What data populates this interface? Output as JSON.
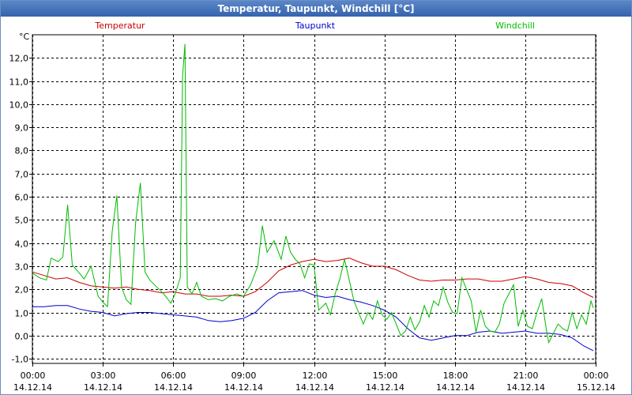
{
  "window": {
    "title": "Temperatur, Taupunkt, Windchill [°C]"
  },
  "chart_data": {
    "type": "line",
    "title": "Temperatur, Taupunkt, Windchill [°C]",
    "ylabel": "°C",
    "xlabel": "",
    "ylim": [
      -1.2,
      13.0
    ],
    "yticks": [
      -1.0,
      0.0,
      1.0,
      2.0,
      3.0,
      4.0,
      5.0,
      6.0,
      7.0,
      8.0,
      9.0,
      10.0,
      11.0,
      12.0
    ],
    "ytick_labels": [
      "-1,0",
      "0,0",
      "1,0",
      "2,0",
      "3,0",
      "4,0",
      "5,0",
      "6,0",
      "7,0",
      "8,0",
      "9,0",
      "10,0",
      "11,0",
      "12,0"
    ],
    "xlim": [
      0,
      24
    ],
    "xticks": [
      {
        "h": 0,
        "time": "00:00",
        "date": "14.12.14"
      },
      {
        "h": 3,
        "time": "03:00",
        "date": "14.12.14"
      },
      {
        "h": 6,
        "time": "06:00",
        "date": "14.12.14"
      },
      {
        "h": 9,
        "time": "09:00",
        "date": "14.12.14"
      },
      {
        "h": 12,
        "time": "12:00",
        "date": "14.12.14"
      },
      {
        "h": 15,
        "time": "15:00",
        "date": "14.12.14"
      },
      {
        "h": 18,
        "time": "18:00",
        "date": "14.12.14"
      },
      {
        "h": 21,
        "time": "21:00",
        "date": "14.12.14"
      },
      {
        "h": 24,
        "time": "00:00",
        "date": "15.12.14"
      }
    ],
    "grid": true,
    "legend_position": "top",
    "series": [
      {
        "name": "Temperatur",
        "color": "#cc0000",
        "points": [
          [
            0,
            2.75
          ],
          [
            0.5,
            2.6
          ],
          [
            1,
            2.45
          ],
          [
            1.5,
            2.5
          ],
          [
            2,
            2.3
          ],
          [
            2.5,
            2.15
          ],
          [
            3,
            2.1
          ],
          [
            3.5,
            2.05
          ],
          [
            4,
            2.1
          ],
          [
            4.5,
            2.0
          ],
          [
            5,
            1.95
          ],
          [
            5.5,
            1.85
          ],
          [
            6,
            1.9
          ],
          [
            6.5,
            1.8
          ],
          [
            7,
            1.8
          ],
          [
            7.5,
            1.7
          ],
          [
            8,
            1.7
          ],
          [
            8.5,
            1.75
          ],
          [
            9,
            1.7
          ],
          [
            9.5,
            1.9
          ],
          [
            10,
            2.3
          ],
          [
            10.5,
            2.8
          ],
          [
            11,
            3.05
          ],
          [
            11.5,
            3.2
          ],
          [
            12,
            3.3
          ],
          [
            12.5,
            3.2
          ],
          [
            13,
            3.25
          ],
          [
            13.5,
            3.35
          ],
          [
            14,
            3.15
          ],
          [
            14.5,
            3.0
          ],
          [
            15,
            3.0
          ],
          [
            15.5,
            2.85
          ],
          [
            16,
            2.6
          ],
          [
            16.5,
            2.4
          ],
          [
            17,
            2.35
          ],
          [
            17.5,
            2.4
          ],
          [
            18,
            2.4
          ],
          [
            18.5,
            2.45
          ],
          [
            19,
            2.45
          ],
          [
            19.5,
            2.35
          ],
          [
            20,
            2.35
          ],
          [
            20.5,
            2.45
          ],
          [
            21,
            2.55
          ],
          [
            21.5,
            2.45
          ],
          [
            22,
            2.3
          ],
          [
            22.5,
            2.25
          ],
          [
            23,
            2.15
          ],
          [
            23.5,
            1.85
          ],
          [
            23.9,
            1.65
          ]
        ]
      },
      {
        "name": "Taupunkt",
        "color": "#0000cc",
        "points": [
          [
            0,
            1.25
          ],
          [
            0.5,
            1.25
          ],
          [
            1,
            1.3
          ],
          [
            1.5,
            1.3
          ],
          [
            2,
            1.15
          ],
          [
            2.5,
            1.05
          ],
          [
            3,
            1.0
          ],
          [
            3.5,
            0.85
          ],
          [
            4,
            0.95
          ],
          [
            4.5,
            1.0
          ],
          [
            5,
            1.0
          ],
          [
            5.5,
            0.95
          ],
          [
            6,
            0.9
          ],
          [
            6.5,
            0.85
          ],
          [
            7,
            0.8
          ],
          [
            7.5,
            0.65
          ],
          [
            8,
            0.6
          ],
          [
            8.5,
            0.65
          ],
          [
            9,
            0.75
          ],
          [
            9.5,
            1.0
          ],
          [
            10,
            1.5
          ],
          [
            10.5,
            1.85
          ],
          [
            11,
            1.9
          ],
          [
            11.5,
            1.95
          ],
          [
            12,
            1.75
          ],
          [
            12.5,
            1.65
          ],
          [
            13,
            1.7
          ],
          [
            13.5,
            1.55
          ],
          [
            14,
            1.45
          ],
          [
            14.5,
            1.3
          ],
          [
            15,
            1.1
          ],
          [
            15.5,
            0.8
          ],
          [
            16,
            0.3
          ],
          [
            16.5,
            -0.1
          ],
          [
            17,
            -0.2
          ],
          [
            17.5,
            -0.1
          ],
          [
            18,
            0.0
          ],
          [
            18.5,
            0.0
          ],
          [
            19,
            0.15
          ],
          [
            19.5,
            0.2
          ],
          [
            20,
            0.1
          ],
          [
            20.5,
            0.15
          ],
          [
            21,
            0.2
          ],
          [
            21.5,
            0.1
          ],
          [
            22,
            0.1
          ],
          [
            22.5,
            0.05
          ],
          [
            23,
            -0.1
          ],
          [
            23.5,
            -0.45
          ],
          [
            23.9,
            -0.65
          ]
        ]
      },
      {
        "name": "Windchill",
        "color": "#00bb00",
        "points": [
          [
            0,
            2.7
          ],
          [
            0.3,
            2.5
          ],
          [
            0.6,
            2.4
          ],
          [
            0.8,
            3.35
          ],
          [
            1.1,
            3.2
          ],
          [
            1.3,
            3.4
          ],
          [
            1.5,
            5.65
          ],
          [
            1.7,
            3.05
          ],
          [
            2.0,
            2.7
          ],
          [
            2.2,
            2.45
          ],
          [
            2.5,
            3.0
          ],
          [
            2.8,
            1.7
          ],
          [
            3.0,
            1.45
          ],
          [
            3.2,
            1.25
          ],
          [
            3.4,
            4.5
          ],
          [
            3.6,
            6.05
          ],
          [
            3.8,
            2.1
          ],
          [
            4.0,
            1.55
          ],
          [
            4.2,
            1.35
          ],
          [
            4.4,
            4.9
          ],
          [
            4.6,
            6.6
          ],
          [
            4.8,
            2.75
          ],
          [
            5.0,
            2.4
          ],
          [
            5.3,
            2.1
          ],
          [
            5.6,
            1.8
          ],
          [
            5.9,
            1.4
          ],
          [
            6.1,
            1.85
          ],
          [
            6.3,
            2.5
          ],
          [
            6.4,
            11.2
          ],
          [
            6.5,
            12.6
          ],
          [
            6.6,
            2.1
          ],
          [
            6.8,
            1.8
          ],
          [
            7.0,
            2.3
          ],
          [
            7.2,
            1.7
          ],
          [
            7.5,
            1.55
          ],
          [
            7.8,
            1.6
          ],
          [
            8.1,
            1.5
          ],
          [
            8.4,
            1.7
          ],
          [
            8.7,
            1.8
          ],
          [
            9.0,
            1.7
          ],
          [
            9.3,
            2.2
          ],
          [
            9.6,
            3.0
          ],
          [
            9.8,
            4.75
          ],
          [
            10.0,
            3.6
          ],
          [
            10.3,
            4.1
          ],
          [
            10.6,
            3.3
          ],
          [
            10.8,
            4.3
          ],
          [
            11.0,
            3.6
          ],
          [
            11.2,
            3.3
          ],
          [
            11.4,
            3.1
          ],
          [
            11.6,
            2.5
          ],
          [
            11.8,
            3.1
          ],
          [
            12.0,
            3.05
          ],
          [
            12.2,
            1.1
          ],
          [
            12.5,
            1.4
          ],
          [
            12.7,
            0.9
          ],
          [
            12.9,
            1.8
          ],
          [
            13.1,
            2.45
          ],
          [
            13.3,
            3.3
          ],
          [
            13.5,
            2.4
          ],
          [
            13.7,
            1.5
          ],
          [
            13.9,
            1.0
          ],
          [
            14.1,
            0.5
          ],
          [
            14.3,
            1.0
          ],
          [
            14.5,
            0.7
          ],
          [
            14.7,
            1.5
          ],
          [
            14.9,
            0.9
          ],
          [
            15.1,
            0.7
          ],
          [
            15.3,
            1.0
          ],
          [
            15.5,
            0.5
          ],
          [
            15.7,
            0.0
          ],
          [
            15.9,
            0.2
          ],
          [
            16.1,
            0.8
          ],
          [
            16.3,
            0.25
          ],
          [
            16.5,
            0.6
          ],
          [
            16.7,
            1.3
          ],
          [
            16.9,
            0.8
          ],
          [
            17.1,
            1.5
          ],
          [
            17.3,
            1.3
          ],
          [
            17.5,
            2.1
          ],
          [
            17.7,
            1.45
          ],
          [
            17.9,
            1.0
          ],
          [
            18.1,
            0.95
          ],
          [
            18.3,
            2.5
          ],
          [
            18.5,
            2.0
          ],
          [
            18.7,
            1.5
          ],
          [
            18.9,
            0.15
          ],
          [
            19.1,
            1.1
          ],
          [
            19.3,
            0.4
          ],
          [
            19.5,
            0.2
          ],
          [
            19.7,
            0.15
          ],
          [
            19.9,
            0.5
          ],
          [
            20.1,
            1.4
          ],
          [
            20.3,
            1.8
          ],
          [
            20.5,
            2.2
          ],
          [
            20.7,
            0.4
          ],
          [
            20.9,
            1.1
          ],
          [
            21.1,
            0.4
          ],
          [
            21.3,
            0.3
          ],
          [
            21.5,
            1.0
          ],
          [
            21.7,
            1.6
          ],
          [
            21.9,
            0.25
          ],
          [
            22.0,
            -0.3
          ],
          [
            22.2,
            0.1
          ],
          [
            22.4,
            0.5
          ],
          [
            22.6,
            0.3
          ],
          [
            22.8,
            0.2
          ],
          [
            23.0,
            1.0
          ],
          [
            23.2,
            0.3
          ],
          [
            23.4,
            0.9
          ],
          [
            23.6,
            0.5
          ],
          [
            23.8,
            1.5
          ],
          [
            23.9,
            1.2
          ]
        ]
      }
    ]
  }
}
